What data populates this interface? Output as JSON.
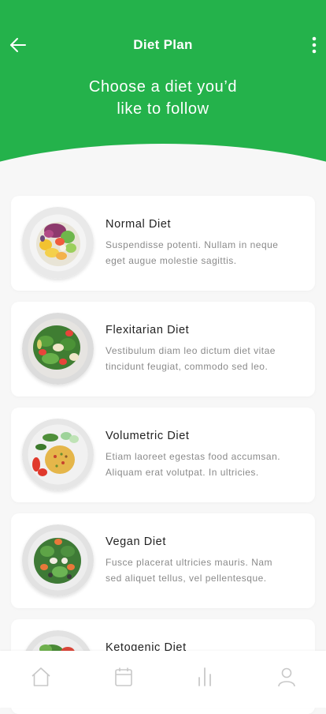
{
  "header": {
    "title": "Diet Plan",
    "headline_line1": "Choose a diet you’d",
    "headline_line2": "like to follow",
    "back_icon": "arrow-left-icon",
    "menu_icon": "more-vertical-icon",
    "background_color": "#24b24b"
  },
  "diets": [
    {
      "name": "Normal Diet",
      "desc_line1": "Suspendisse potenti. Nullam in neque",
      "desc_line2": "eget augue molestie sagittis."
    },
    {
      "name": "Flexitarian Diet",
      "desc_line1": "Vestibulum diam leo dictum diet vitae",
      "desc_line2": "tincidunt feugiat, commodo sed leo."
    },
    {
      "name": "Volumetric Diet",
      "desc_line1": "Etiam laoreet egestas food accumsan.",
      "desc_line2": "Aliquam erat volutpat. In ultricies."
    },
    {
      "name": "Vegan Diet",
      "desc_line1": "Fusce placerat ultricies mauris. Nam",
      "desc_line2": "sed aliquet tellus, vel pellentesque."
    },
    {
      "name": "Ketogenic Diet",
      "desc_line1": "",
      "desc_line2": ""
    }
  ],
  "tabbar": {
    "items": [
      {
        "icon": "home-icon"
      },
      {
        "icon": "calendar-icon"
      },
      {
        "icon": "bar-chart-icon"
      },
      {
        "icon": "user-icon"
      }
    ],
    "icon_color": "#c8c8c8"
  }
}
